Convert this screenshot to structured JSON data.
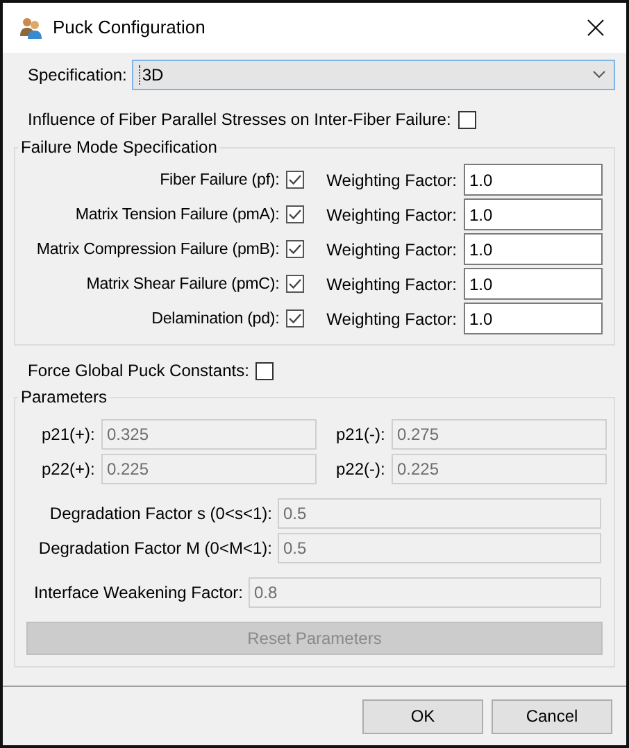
{
  "window": {
    "title": "Puck Configuration"
  },
  "specification": {
    "label": "Specification:",
    "value": "3D"
  },
  "influence": {
    "label": "Influence of Fiber Parallel Stresses on Inter-Fiber Failure:",
    "checked": false
  },
  "failure_modes": {
    "title": "Failure Mode Specification",
    "rows": [
      {
        "label": "Fiber Failure (pf):",
        "checked": true,
        "factor_label": "Weighting Factor:",
        "factor": "1.0"
      },
      {
        "label": "Matrix Tension Failure (pmA):",
        "checked": true,
        "factor_label": "Weighting Factor:",
        "factor": "1.0"
      },
      {
        "label": "Matrix Compression Failure (pmB):",
        "checked": true,
        "factor_label": "Weighting Factor:",
        "factor": "1.0"
      },
      {
        "label": "Matrix Shear Failure (pmC):",
        "checked": true,
        "factor_label": "Weighting Factor:",
        "factor": "1.0"
      },
      {
        "label": "Delamination (pd):",
        "checked": true,
        "factor_label": "Weighting Factor:",
        "factor": "1.0"
      }
    ]
  },
  "force_global": {
    "label": "Force Global Puck Constants:",
    "checked": false
  },
  "parameters": {
    "title": "Parameters",
    "disabled": true,
    "grid": [
      {
        "label": "p21(+):",
        "value": "0.325"
      },
      {
        "label": "p21(-):",
        "value": "0.275"
      },
      {
        "label": "p22(+):",
        "value": "0.225"
      },
      {
        "label": "p22(-):",
        "value": "0.225"
      }
    ],
    "degradation": [
      {
        "label": "Degradation Factor s (0<s<1):",
        "value": "0.5"
      },
      {
        "label": "Degradation Factor M (0<M<1):",
        "value": "0.5"
      }
    ],
    "interface": {
      "label": "Interface Weakening Factor:",
      "value": "0.8"
    },
    "reset_button": "Reset Parameters"
  },
  "buttons": [
    {
      "label": "OK"
    },
    {
      "label": "Cancel"
    }
  ]
}
